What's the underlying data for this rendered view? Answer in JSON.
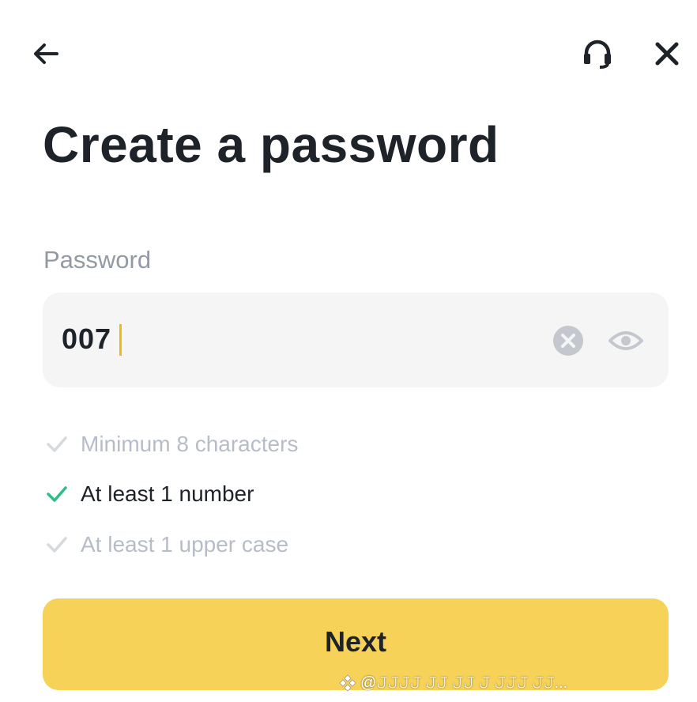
{
  "header": {
    "back_icon": "arrow-left-icon",
    "support_icon": "headset-icon",
    "close_icon": "close-icon"
  },
  "title": "Create a password",
  "password_field": {
    "label": "Password",
    "value": "007",
    "clear_icon": "clear-circle-icon",
    "visibility_icon": "eye-icon"
  },
  "requirements": [
    {
      "text": "Minimum 8 characters",
      "met": false
    },
    {
      "text": "At least 1 number",
      "met": true
    },
    {
      "text": "At least 1 upper case",
      "met": false
    }
  ],
  "next_button": {
    "label": "Next"
  },
  "watermark": {
    "text": "@𝙹𝙹𝙹𝙹 𝙹𝙹 𝙹𝙹 𝙹 𝙹𝙹𝙹 𝙹𝙹..."
  },
  "colors": {
    "primary_text": "#1e2329",
    "muted_text": "#929aa5",
    "unmet_text": "#b7bdc6",
    "check_met": "#2ebd85",
    "input_bg": "#f5f5f5",
    "button_bg": "#f6d258",
    "caret": "#f0b90b"
  }
}
